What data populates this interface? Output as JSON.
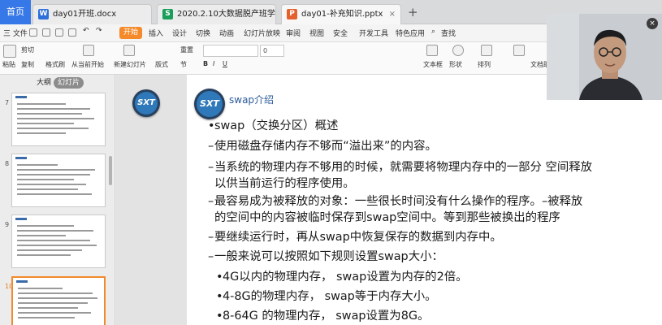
{
  "tabs": {
    "home": "首页",
    "docs": [
      {
        "label": "day01开班.docx",
        "icon": "W",
        "color": "#2e6fd8"
      },
      {
        "label": "2020.2.10大数据脱产班学生信息",
        "icon": "S",
        "color": "#1a9f5a"
      },
      {
        "label": "day01-补充知识.pptx",
        "icon": "P",
        "color": "#e4612e"
      }
    ],
    "close": "×",
    "add": "+"
  },
  "menubar": {
    "file": "三 文件",
    "start": "开始",
    "items": [
      "插入",
      "设计",
      "切换",
      "动画",
      "幻灯片放映",
      "审阅",
      "视图",
      "安全",
      "开发工具",
      "特色应用"
    ],
    "search": "查找"
  },
  "ribbon": {
    "paste": "粘贴",
    "cut": "剪切",
    "copy": "复制",
    "format_painter": "格式刷",
    "play_from_current": "从当前开始",
    "new_slide": "新建幻灯片",
    "layout": "版式",
    "section": "节",
    "reset": "重置",
    "font_size": "0",
    "textbox": "文本框",
    "shape": "形状",
    "arrange": "排列",
    "doc_assist": "文档助"
  },
  "sidebar": {
    "tab_outline": "大纲",
    "tab_slides": "幻灯片",
    "slide_numbers": [
      "7",
      "8",
      "9",
      "10"
    ]
  },
  "slide": {
    "logo_text": "SXT",
    "title": "swap介绍",
    "bullets": [
      {
        "mark": "•",
        "text": "swap（交换分区）概述"
      },
      {
        "mark": "–",
        "text": "使用磁盘存储内存不够而“溢出来”的内容。"
      },
      {
        "mark": "–",
        "text": "当系统的物理内存不够用的时候，就需要将物理内存中的一部分 空间释放"
      },
      {
        "mark": "",
        "text": "以供当前运行的程序使用。"
      },
      {
        "mark": "–",
        "text": "最容易成为被释放的对象：一些很长时间没有什么操作的程序。–被释放"
      },
      {
        "mark": "",
        "text": "的空间中的内容被临时保存到swap空间中。等到那些被换出的程序"
      },
      {
        "mark": "–",
        "text": "要继续运行时，再从swap中恢复保存的数据到内存中。"
      },
      {
        "mark": "–",
        "text": "一般来说可以按照如下规则设置swap大小："
      },
      {
        "mark": "•",
        "text": "4G以内的物理内存， swap设置为内存的2倍。"
      },
      {
        "mark": "•",
        "text": "4-8G的物理内存， swap等于内存大小。"
      },
      {
        "mark": "•",
        "text": "8-64G 的物理内存， swap设置为8G。"
      }
    ]
  },
  "webcam": {
    "close": "×"
  }
}
